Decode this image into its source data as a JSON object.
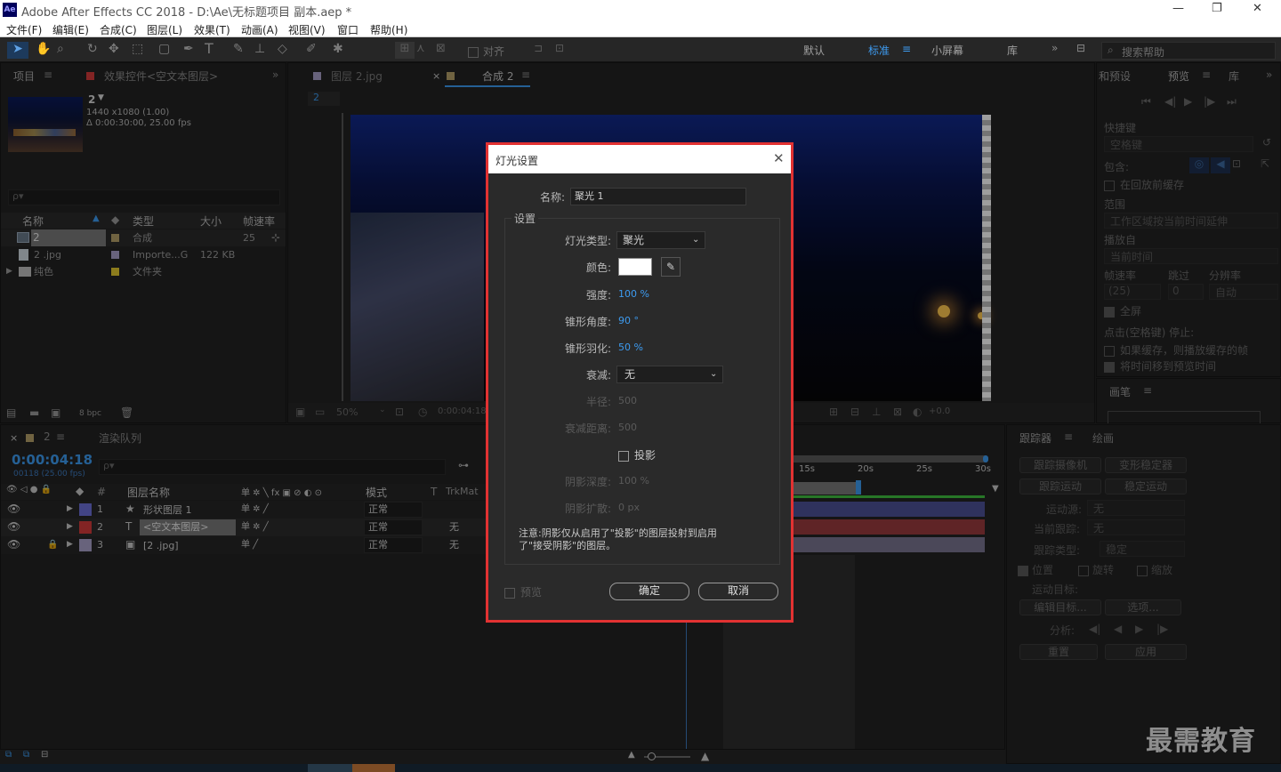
{
  "app": {
    "title": "Adobe After Effects CC 2018 - D:\\Ae\\无标题项目 副本.aep *",
    "logo": "Ae",
    "window_controls": {
      "minimize": "—",
      "restore": "❐",
      "close": "✕"
    }
  },
  "menu": [
    "文件(F)",
    "编辑(E)",
    "合成(C)",
    "图层(L)",
    "效果(T)",
    "动画(A)",
    "视图(V)",
    "窗口",
    "帮助(H)"
  ],
  "toolbar": {
    "align_label": "对齐",
    "workspaces": [
      "默认",
      "标准",
      "小屏幕",
      "库"
    ],
    "active_workspace": "标准",
    "search_placeholder": "搜索帮助"
  },
  "project_panel": {
    "tab_project": "项目",
    "tab_effects": "效果控件<空文本图层>",
    "item_name": "2",
    "item_size": "1440 x1080 (1.00)",
    "item_duration": "Δ 0:00:30:00, 25.00 fps",
    "search_placeholder": "ρ▾",
    "columns": [
      "名称",
      "类型",
      "大小",
      "帧速率"
    ],
    "rows": [
      {
        "name": "2",
        "type": "合成",
        "size": "",
        "fps": "25",
        "color": "#b5a06a"
      },
      {
        "name": "2 .jpg",
        "type": "Importe...G",
        "size": "122 KB",
        "fps": "",
        "color": "#a9a0c8"
      },
      {
        "name": "纯色",
        "type": "文件夹",
        "size": "",
        "fps": "",
        "color": "#e3c92f"
      }
    ],
    "bpc": "8 bpc"
  },
  "viewer": {
    "tab_layer": "图层 2.jpg",
    "tab_comp": "合成 2",
    "comp_breadcrumb": "2",
    "zoom": "50%",
    "timecode": "0:00:04:18",
    "exposure": "+0.0"
  },
  "right_panel": {
    "tab_info": "和预设",
    "tab_preview": "预览",
    "tab_lib": "库",
    "shortcut_label": "快捷键",
    "shortcut_value": "空格键",
    "include_label": "包含:",
    "cache_label": "在回放前缓存",
    "range_label": "范围",
    "range_value": "工作区域按当前时间延伸",
    "play_from_label": "播放自",
    "play_from_value": "当前时间",
    "fps_label": "帧速率",
    "skip_label": "跳过",
    "res_label": "分辨率",
    "fps_value": "(25)",
    "skip_value": "0",
    "res_value": "自动",
    "fullscreen_label": "全屏",
    "stop_label": "点击(空格键) 停止:",
    "opt1": "如果缓存，则播放缓存的帧",
    "opt2": "将时间移到预览时间",
    "brush_tab": "画笔"
  },
  "timeline": {
    "tab_comp": "2",
    "tab_render": "渲染队列",
    "timecode": "0:00:04:18",
    "frame_info": "00118 (25.00 fps)",
    "search_placeholder": "ρ▾",
    "col_layer_name": "图层名称",
    "col_mode": "模式",
    "col_t": "T",
    "col_trkmat": "TrkMat",
    "ruler": [
      "15s",
      "20s",
      "25s",
      "30s"
    ],
    "layers": [
      {
        "num": "1",
        "name": "形状图层 1",
        "mode": "正常",
        "trkmat": "",
        "color": "#6b6fd6",
        "icon": "★"
      },
      {
        "num": "2",
        "name": "<空文本图层>",
        "mode": "正常",
        "trkmat": "无",
        "color": "#d43b3b",
        "icon": "T"
      },
      {
        "num": "3",
        "name": "[2 .jpg]",
        "mode": "正常",
        "trkmat": "无",
        "color": "#a9a0c8",
        "icon": "▣"
      }
    ]
  },
  "tracker_panel": {
    "tab_tracker": "跟踪器",
    "tab_paint": "绘画",
    "btn_track_camera": "跟踪摄像机",
    "btn_warp_stabilizer": "变形稳定器",
    "btn_track_motion": "跟踪运动",
    "btn_stabilize_motion": "稳定运动",
    "motion_source_label": "运动源:",
    "motion_source_value": "无",
    "current_track_label": "当前跟踪:",
    "current_track_value": "无",
    "track_type_label": "跟踪类型:",
    "track_type_value": "稳定",
    "chk_position": "位置",
    "chk_rotation": "旋转",
    "chk_scale": "缩放",
    "motion_target_label": "运动目标:",
    "btn_edit_target": "编辑目标...",
    "btn_options": "选项...",
    "analyze_label": "分析:",
    "btn_reset": "重置",
    "btn_apply": "应用"
  },
  "dialog": {
    "title": "灯光设置",
    "name_label": "名称:",
    "name_value": "聚光 1",
    "settings_label": "设置",
    "light_type_label": "灯光类型:",
    "light_type_value": "聚光",
    "color_label": "颜色:",
    "color_value": "#ffffff",
    "intensity_label": "强度:",
    "intensity_value": "100 %",
    "cone_angle_label": "锥形角度:",
    "cone_angle_value": "90 °",
    "cone_feather_label": "锥形羽化:",
    "cone_feather_value": "50 %",
    "falloff_label": "衰减:",
    "falloff_value": "无",
    "radius_label": "半径:",
    "radius_value": "500",
    "falloff_distance_label": "衰减距离:",
    "falloff_distance_value": "500",
    "casts_shadows_label": "投影",
    "shadow_darkness_label": "阴影深度:",
    "shadow_darkness_value": "100 %",
    "shadow_diffusion_label": "阴影扩散:",
    "shadow_diffusion_value": "0 px",
    "note_line1": "注意:阴影仅从启用了\"投影\"的图层投射到启用",
    "note_line2": "了\"接受阴影\"的图层。",
    "preview_label": "预览",
    "ok_label": "确定",
    "cancel_label": "取消"
  },
  "watermark": "最需教育"
}
